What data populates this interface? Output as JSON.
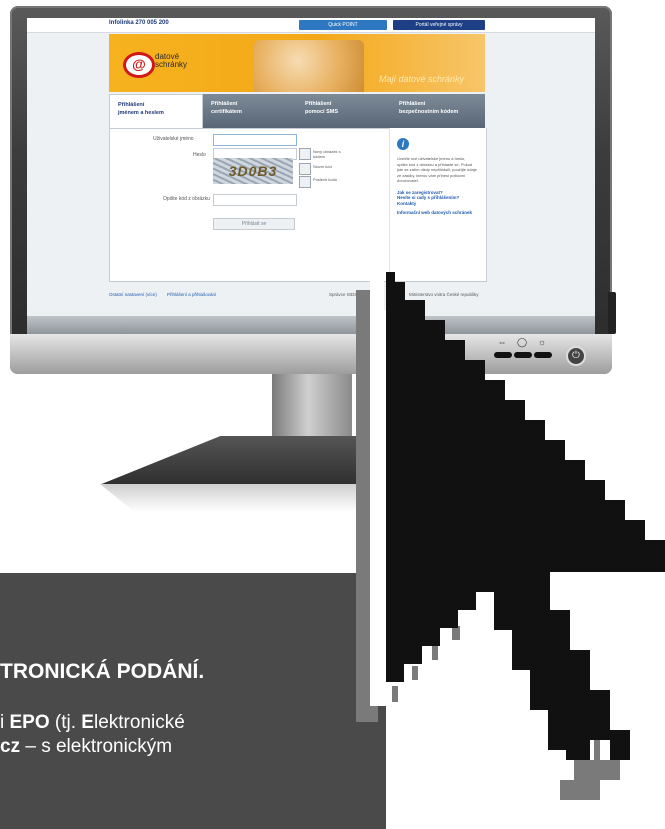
{
  "website": {
    "infoline": "Infolinka 270 005 200",
    "quick_point": "Quick POINT",
    "portal_link": "Portál veřejné správy",
    "logo_text_1": "datové",
    "logo_text_2": "schránky",
    "slogan": "Mají datové schránky",
    "tabs": [
      {
        "line1": "Přihlášení",
        "line2": "jménem a heslem"
      },
      {
        "line1": "Přihlášení",
        "line2": "certifikátem"
      },
      {
        "line1": "Přihlášení",
        "line2": "pomocí SMS"
      },
      {
        "line1": "Přihlášení",
        "line2": "bezpečnostním kódem"
      }
    ],
    "form": {
      "username_label": "Uživatelské jméno",
      "password_label": "Heslo",
      "captcha_label": "Opište kód z obrázku",
      "captcha_text": "3D0B3",
      "refresh_label": "Nový obrázek s kódem",
      "audio_label": "Slovní kód",
      "help_label": "Poslech kódu",
      "login_button": "Přihlásit se"
    },
    "info": {
      "text": "Uveďte své uživatelské jméno a heslo, opište kód z obrázku a přihlaste se. Pokud jste se zatím nikdy nepřihlásili, použijte údaje ze zásilky, kterou vám přinesl poštovní doručovatel.",
      "link1": "Jak se zaregistrovat?",
      "link2": "Nevíte si rady s přihlášením?",
      "link3": "Kontakty",
      "link4": "Informační web datových schránek"
    },
    "footer": {
      "left_link": "Ostatní nastavení (více)",
      "middle_link": "Přihlášení a přihlašování",
      "right_text": "Správce ISDS",
      "copyright": "Ministerstvo vnitra České republiky"
    }
  },
  "panel": {
    "headline": "TRONICKÁ PODÁNÍ.",
    "line1_prefix": "i ",
    "line1_bold1": "EPO",
    "line1_mid": " (tj. ",
    "line1_bold2": "E",
    "line1_rest": "lektronické",
    "line2_bold": "cz",
    "line2_rest": " – s elektronickým"
  },
  "colors": {
    "panel_bg": "#4a4a4a",
    "banner": "#f4a818",
    "accent_blue": "#2e78c2",
    "cursor_black": "#111111",
    "cursor_gray": "#7a7a7a"
  },
  "icons": [
    "at-sign-logo-icon",
    "info-icon",
    "refresh-icon",
    "audio-icon",
    "power-icon",
    "mouse-cursor-icon"
  ]
}
